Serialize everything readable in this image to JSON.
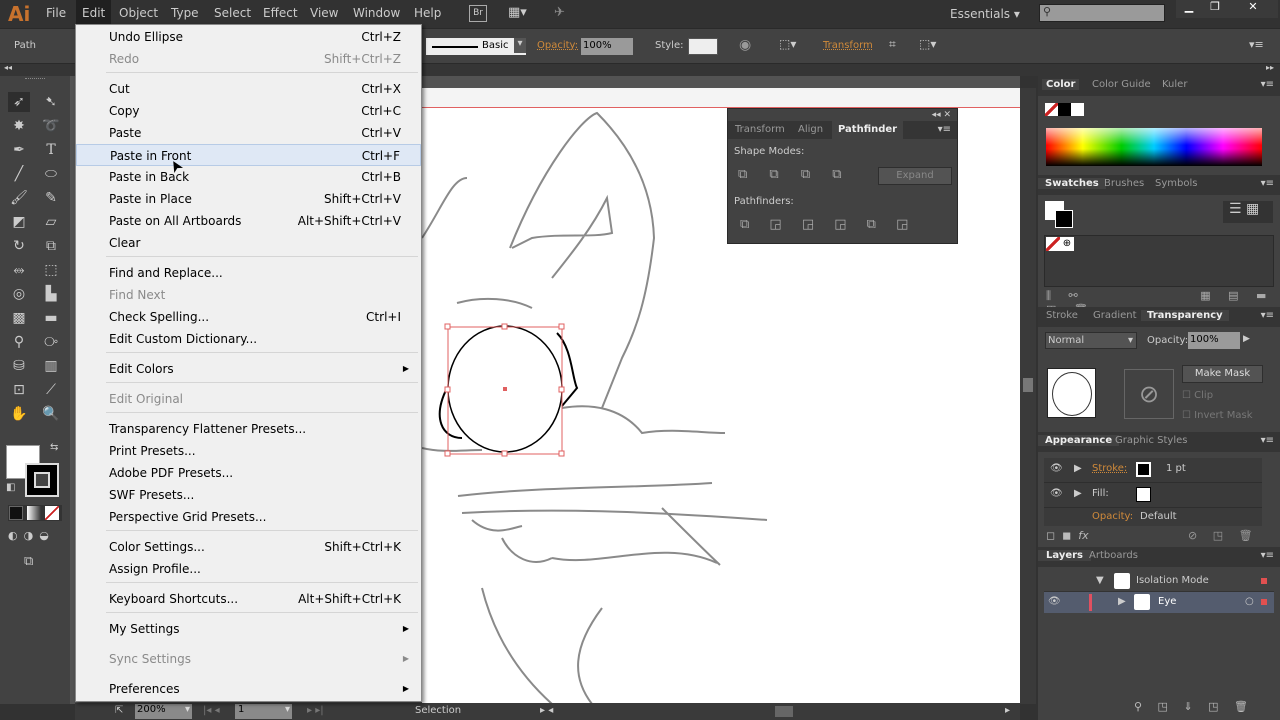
{
  "app": {
    "logo": "Ai"
  },
  "menubar": [
    "File",
    "Edit",
    "Object",
    "Type",
    "Select",
    "Effect",
    "View",
    "Window",
    "Help"
  ],
  "bridge": "Br",
  "workspace": "Essentials",
  "control": {
    "selection": "Path",
    "stroke_style": "Basic",
    "opacity_label": "Opacity:",
    "opacity": "100%",
    "style_label": "Style:",
    "transform": "Transform"
  },
  "edit_menu": [
    {
      "label": "Undo Ellipse",
      "shortcut": "Ctrl+Z"
    },
    {
      "label": "Redo",
      "shortcut": "Shift+Ctrl+Z",
      "disabled": true
    },
    {
      "label": "Cut",
      "shortcut": "Ctrl+X"
    },
    {
      "label": "Copy",
      "shortcut": "Ctrl+C"
    },
    {
      "label": "Paste",
      "shortcut": "Ctrl+V"
    },
    {
      "label": "Paste in Front",
      "shortcut": "Ctrl+F",
      "highlighted": true
    },
    {
      "label": "Paste in Back",
      "shortcut": "Ctrl+B"
    },
    {
      "label": "Paste in Place",
      "shortcut": "Shift+Ctrl+V"
    },
    {
      "label": "Paste on All Artboards",
      "shortcut": "Alt+Shift+Ctrl+V"
    },
    {
      "label": "Clear",
      "shortcut": ""
    },
    {
      "label": "Find and Replace...",
      "shortcut": ""
    },
    {
      "label": "Find Next",
      "shortcut": "",
      "disabled": true
    },
    {
      "label": "Check Spelling...",
      "shortcut": "Ctrl+I"
    },
    {
      "label": "Edit Custom Dictionary...",
      "shortcut": ""
    },
    {
      "label": "Edit Colors",
      "shortcut": "",
      "submenu": true
    },
    {
      "label": "Edit Original",
      "shortcut": "",
      "disabled": true
    },
    {
      "label": "Transparency Flattener Presets...",
      "shortcut": ""
    },
    {
      "label": "Print Presets...",
      "shortcut": ""
    },
    {
      "label": "Adobe PDF Presets...",
      "shortcut": ""
    },
    {
      "label": "SWF Presets...",
      "shortcut": ""
    },
    {
      "label": "Perspective Grid Presets...",
      "shortcut": ""
    },
    {
      "label": "Color Settings...",
      "shortcut": "Shift+Ctrl+K"
    },
    {
      "label": "Assign Profile...",
      "shortcut": ""
    },
    {
      "label": "Keyboard Shortcuts...",
      "shortcut": "Alt+Shift+Ctrl+K"
    },
    {
      "label": "My Settings",
      "shortcut": "",
      "submenu": true
    },
    {
      "label": "Sync Settings",
      "shortcut": "",
      "submenu": true,
      "disabled": true
    },
    {
      "label": "Preferences",
      "shortcut": "",
      "submenu": true
    }
  ],
  "pathfinder": {
    "tabs": [
      "Transform",
      "Align",
      "Pathfinder"
    ],
    "shape_modes": "Shape Modes:",
    "pathfinders": "Pathfinders:",
    "expand": "Expand"
  },
  "color_panel": {
    "tabs": [
      "Color",
      "Color Guide",
      "Kuler"
    ]
  },
  "swatches_panel": {
    "tabs": [
      "Swatches",
      "Brushes",
      "Symbols"
    ]
  },
  "transparency_panel": {
    "tabs": [
      "Stroke",
      "Gradient",
      "Transparency"
    ],
    "blend_mode": "Normal",
    "opacity_label": "Opacity:",
    "opacity": "100%",
    "make_mask": "Make Mask",
    "clip": "Clip",
    "invert_mask": "Invert Mask"
  },
  "appearance_panel": {
    "tabs": [
      "Appearance",
      "Graphic Styles"
    ],
    "stroke_label": "Stroke:",
    "stroke_value": "1 pt",
    "fill_label": "Fill:",
    "opacity_label": "Opacity:",
    "opacity_value": "Default",
    "fx": "fx"
  },
  "layers_panel": {
    "tabs": [
      "Layers",
      "Artboards"
    ],
    "rows": [
      "Isolation Mode",
      "Eye"
    ]
  },
  "status": {
    "zoom": "200%",
    "artboard": "1",
    "tool": "Selection"
  }
}
